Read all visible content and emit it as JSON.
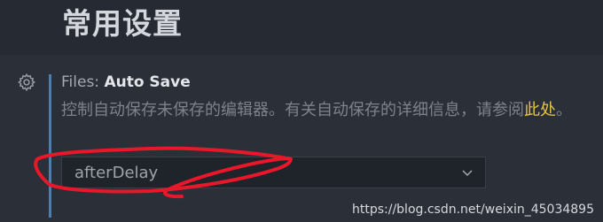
{
  "section": {
    "title": "常用设置"
  },
  "setting": {
    "category": "Files: ",
    "name": "Auto Save",
    "description": "控制自动保存未保存的编辑器。有关自动保存的详细信息，请参阅",
    "description_link": "此处",
    "description_end": "。",
    "value": "afterDelay",
    "icons": {
      "gear": "gear-icon",
      "dropdown": "chevron-down-icon"
    }
  },
  "annotation": {
    "color": "#e8172a",
    "shape": "hand-drawn red circle around the dropdown"
  },
  "watermark": "https://blog.csdn.net/weixin_45034895",
  "colors": {
    "background": "#262a33",
    "focus_bar": "#4d7eb0",
    "link": "#e7c547"
  }
}
